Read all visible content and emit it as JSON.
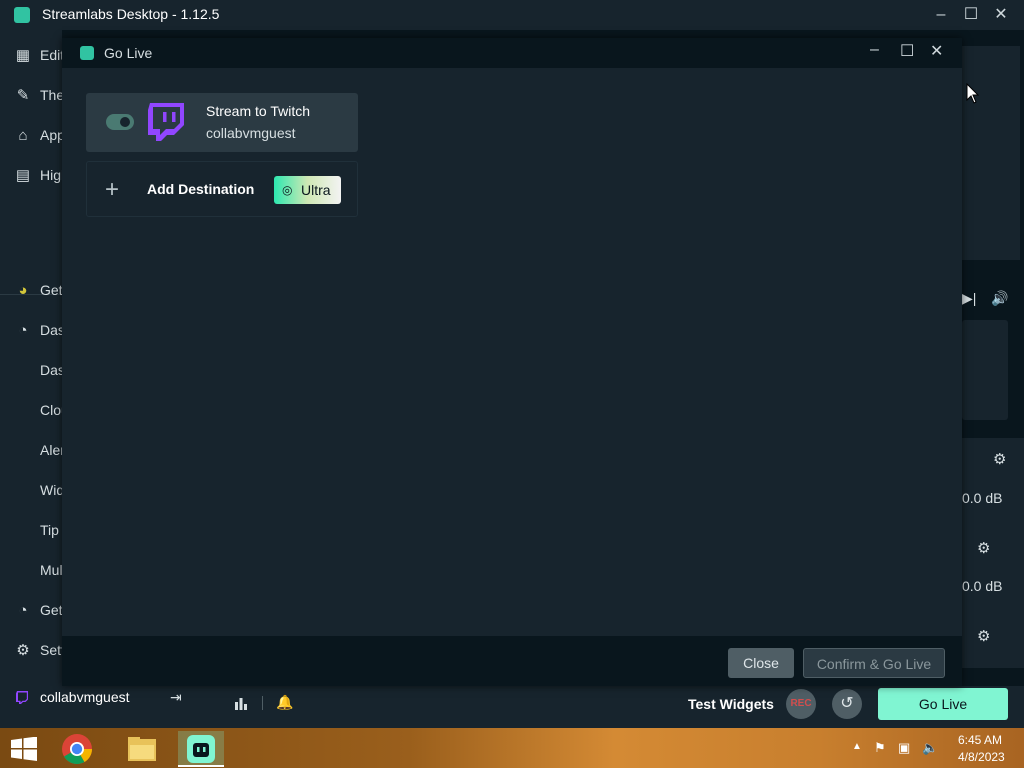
{
  "app": {
    "title": "Streamlabs Desktop - 1.12.5",
    "window_controls": [
      "minimize",
      "maximize",
      "close"
    ]
  },
  "sidebar": {
    "top_items": [
      {
        "icon": "editor-icon",
        "label": "Editor"
      },
      {
        "icon": "themes-icon",
        "label": "Themes"
      },
      {
        "icon": "app-store-icon",
        "label": "App Store"
      },
      {
        "icon": "highlighter-icon",
        "label": "Highlighter"
      }
    ],
    "bottom_items": [
      {
        "icon": "get-started-icon",
        "label": "Get"
      },
      {
        "icon": "dashboard-icon",
        "label": "Dashboard"
      },
      {
        "icon": "",
        "label": "Dashboard"
      },
      {
        "icon": "",
        "label": "Cloudbot"
      },
      {
        "icon": "",
        "label": "Alert Box"
      },
      {
        "icon": "",
        "label": "Widgets"
      },
      {
        "icon": "",
        "label": "Tip Page"
      },
      {
        "icon": "",
        "label": "Multistream"
      },
      {
        "icon": "get-prime-icon",
        "label": "Get"
      },
      {
        "icon": "settings-icon",
        "label": "Settings"
      }
    ],
    "user": "collabvmguest"
  },
  "right_panel": {
    "db_values": [
      "0.0 dB",
      "0.0 dB"
    ]
  },
  "bottombar": {
    "test_widgets": "Test Widgets",
    "rec_label": "REC",
    "go_live": "Go Live"
  },
  "dialog": {
    "title": "Go Live",
    "destination": {
      "title": "Stream to Twitch",
      "user": "collabvmguest",
      "enabled": true
    },
    "add_destination": "Add Destination",
    "ultra": "Ultra",
    "close": "Close",
    "confirm": "Confirm & Go Live"
  },
  "taskbar": {
    "time": "6:45 AM",
    "date": "4/8/2023"
  },
  "colors": {
    "accent": "#80f5d2",
    "twitch": "#9146ff",
    "bg_dark": "#09161d",
    "bg_panel": "#17242d"
  }
}
